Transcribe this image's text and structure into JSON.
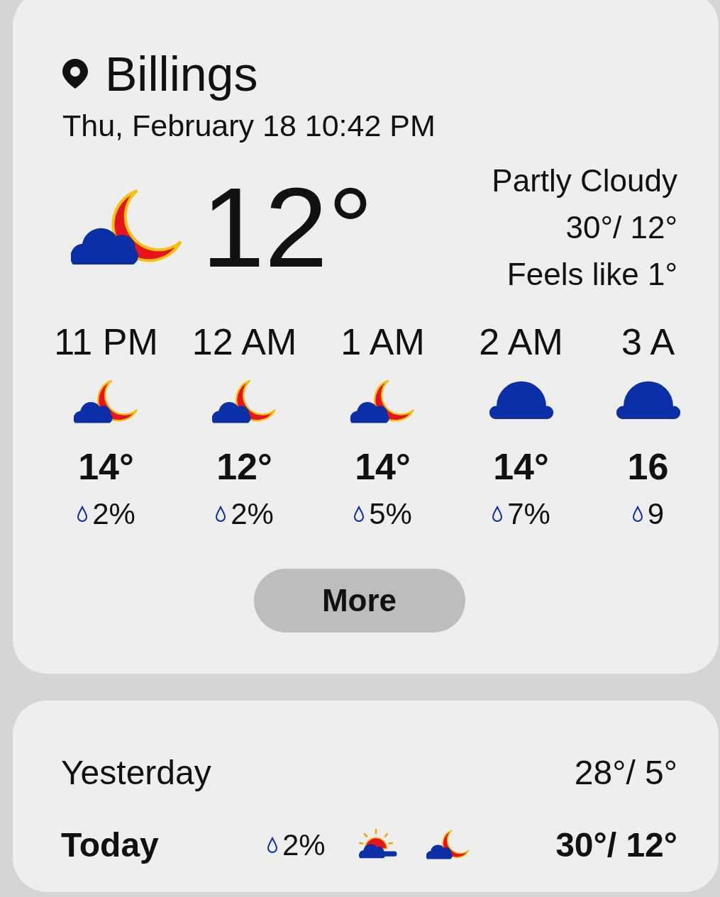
{
  "location": {
    "name": "Billings",
    "datetime": "Thu, February 18 10:42 PM"
  },
  "current": {
    "kind": "night_partly",
    "temperature": "12°",
    "condition": "Partly Cloudy",
    "high_low": "30°/ 12°",
    "feels_like": "Feels like 1°"
  },
  "hourly": [
    {
      "time": "11 PM",
      "kind": "night_partly",
      "temperature": "14°",
      "precip": "2%"
    },
    {
      "time": "12 AM",
      "kind": "night_partly",
      "temperature": "12°",
      "precip": "2%"
    },
    {
      "time": "1 AM",
      "kind": "night_partly",
      "temperature": "14°",
      "precip": "5%"
    },
    {
      "time": "2 AM",
      "kind": "cloudy",
      "temperature": "14°",
      "precip": "7%"
    },
    {
      "time": "3 A",
      "kind": "cloudy",
      "temperature": "16",
      "precip": "9"
    }
  ],
  "more_button": "More",
  "daily": [
    {
      "day": "Yesterday",
      "current": false,
      "high_low": "28°/ 5°"
    },
    {
      "day": "Today",
      "current": true,
      "precip": "2%",
      "icons": [
        {
          "kind": "day_partly"
        },
        {
          "kind": "night_partly"
        }
      ],
      "high_low": "30°/ 12°"
    }
  ]
}
